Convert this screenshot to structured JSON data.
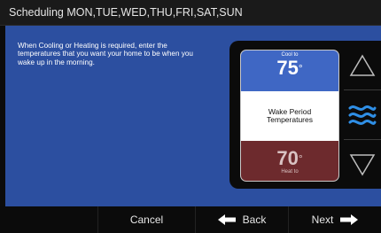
{
  "title": "Scheduling MON,TUE,WED,THU,FRI,SAT,SUN",
  "instructions": "When Cooling or Heating is required, enter the temperatures that you want your home to be when you wake up in the morning.",
  "card": {
    "cool_label": "Cool to",
    "cool_temp": "75",
    "period_line1": "Wake Period",
    "period_line2": "Temperatures",
    "heat_temp": "70",
    "heat_label": "Heat to",
    "degree": "°"
  },
  "side_buttons": [
    "up-arrow-icon",
    "wave-mode-icon",
    "down-arrow-icon"
  ],
  "bottom": {
    "cancel": "Cancel",
    "back": "Back",
    "next": "Next"
  },
  "colors": {
    "background_blue": "#2c4fa0",
    "cool_blue": "#3f67c4",
    "heat_red": "#6d2a2d",
    "wave_blue": "#2f8fe6"
  }
}
